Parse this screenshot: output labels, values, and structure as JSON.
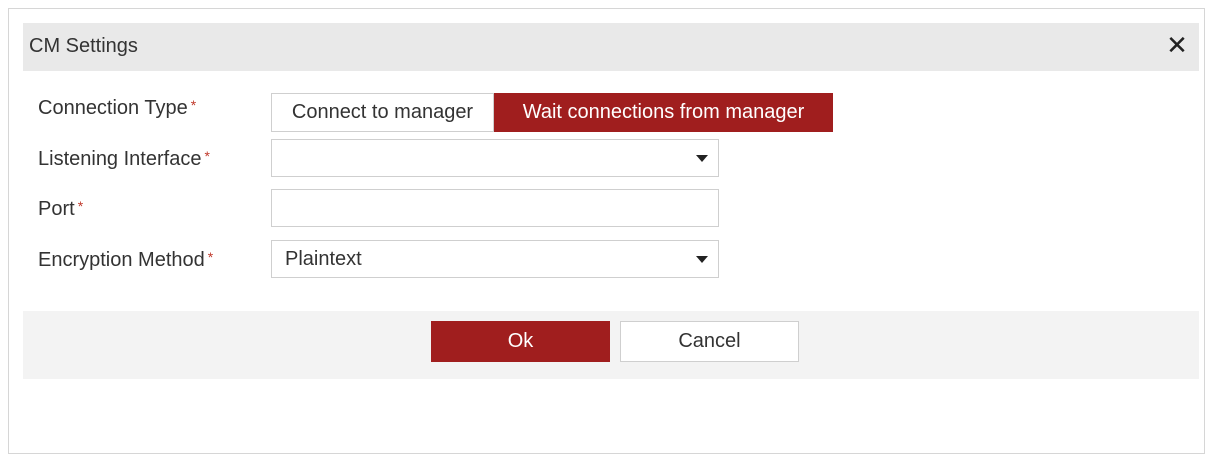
{
  "dialog": {
    "title": "CM Settings",
    "close_symbol": "✕",
    "close_icon": "close-icon"
  },
  "form": {
    "connection_type": {
      "label": "Connection Type",
      "required": "*",
      "options": [
        "Connect to manager",
        "Wait connections from manager"
      ],
      "selected": "Wait connections from manager"
    },
    "listening_interface": {
      "label": "Listening Interface",
      "required": "*",
      "value": ""
    },
    "port": {
      "label": "Port",
      "required": "*",
      "value": ""
    },
    "encryption_method": {
      "label": "Encryption Method",
      "required": "*",
      "value": "Plaintext"
    }
  },
  "footer": {
    "ok_label": "Ok",
    "cancel_label": "Cancel"
  },
  "colors": {
    "accent": "#a01e1e",
    "required_marker": "#c0392b",
    "titlebar_bg": "#e9e9e9",
    "footer_bg": "#f3f3f3"
  }
}
